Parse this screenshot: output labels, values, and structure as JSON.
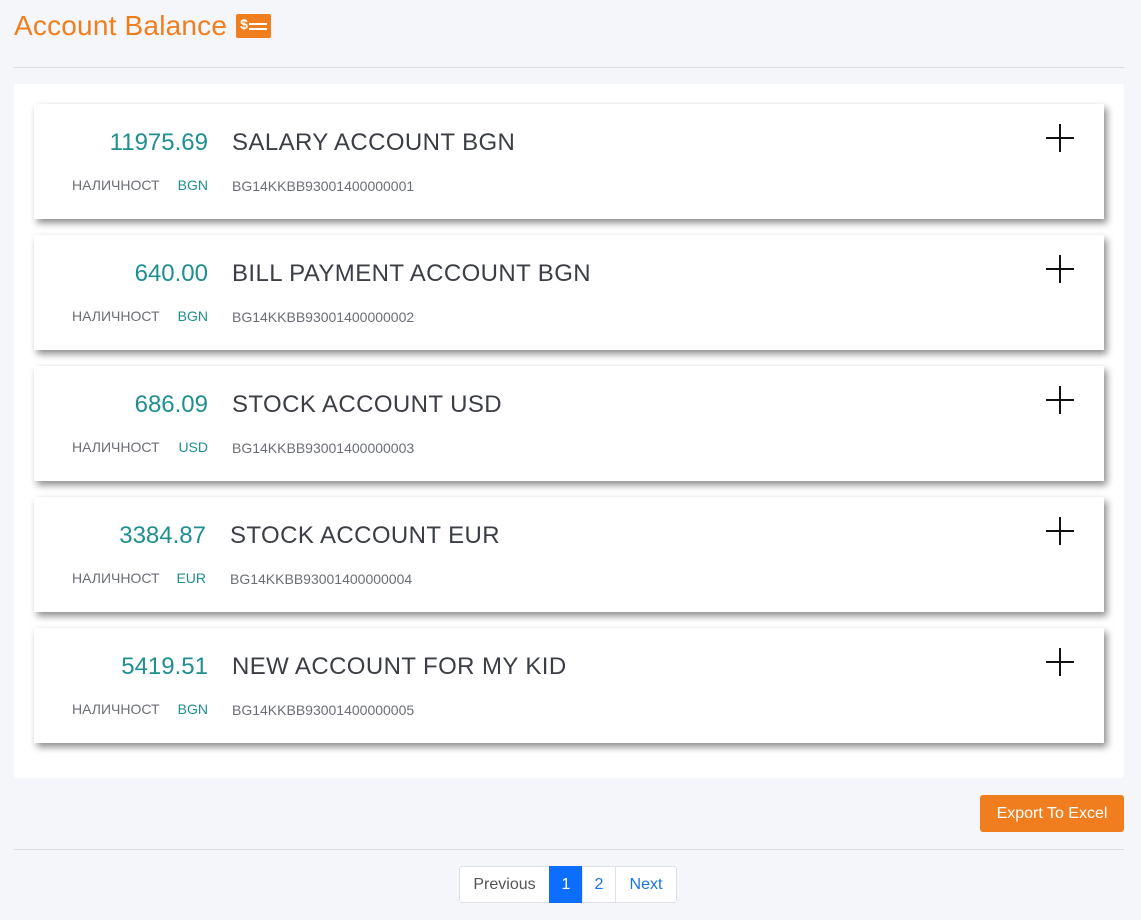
{
  "header": {
    "title": "Account Balance",
    "icon": "money-card-icon",
    "icon_symbol": "$"
  },
  "accounts": [
    {
      "amount": "11975.69",
      "name": "SALARY ACCOUNT BGN",
      "available_label": "НАЛИЧНОСТ",
      "currency": "BGN",
      "iban": "BG14KKBB93001400000001"
    },
    {
      "amount": "640.00",
      "name": "BILL PAYMENT ACCOUNT BGN",
      "available_label": "НАЛИЧНОСТ",
      "currency": "BGN",
      "iban": "BG14KKBB93001400000002"
    },
    {
      "amount": "686.09",
      "name": "STOCK ACCOUNT USD",
      "available_label": "НАЛИЧНОСТ",
      "currency": "USD",
      "iban": "BG14KKBB93001400000003"
    },
    {
      "amount": "3384.87",
      "name": "STOCK ACCOUNT EUR",
      "available_label": "НАЛИЧНОСТ",
      "currency": "EUR",
      "iban": "BG14KKBB93001400000004"
    },
    {
      "amount": "5419.51",
      "name": "NEW ACCOUNT FOR MY KID",
      "available_label": "НАЛИЧНОСТ",
      "currency": "BGN",
      "iban": "BG14KKBB93001400000005"
    }
  ],
  "actions": {
    "export_label": "Export To Excel"
  },
  "pagination": {
    "previous": "Previous",
    "pages": [
      "1",
      "2"
    ],
    "active_page": "1",
    "next": "Next"
  },
  "colors": {
    "accent": "#f07e1f",
    "amount": "#1f8f8f",
    "page_active": "#0d6efd"
  }
}
